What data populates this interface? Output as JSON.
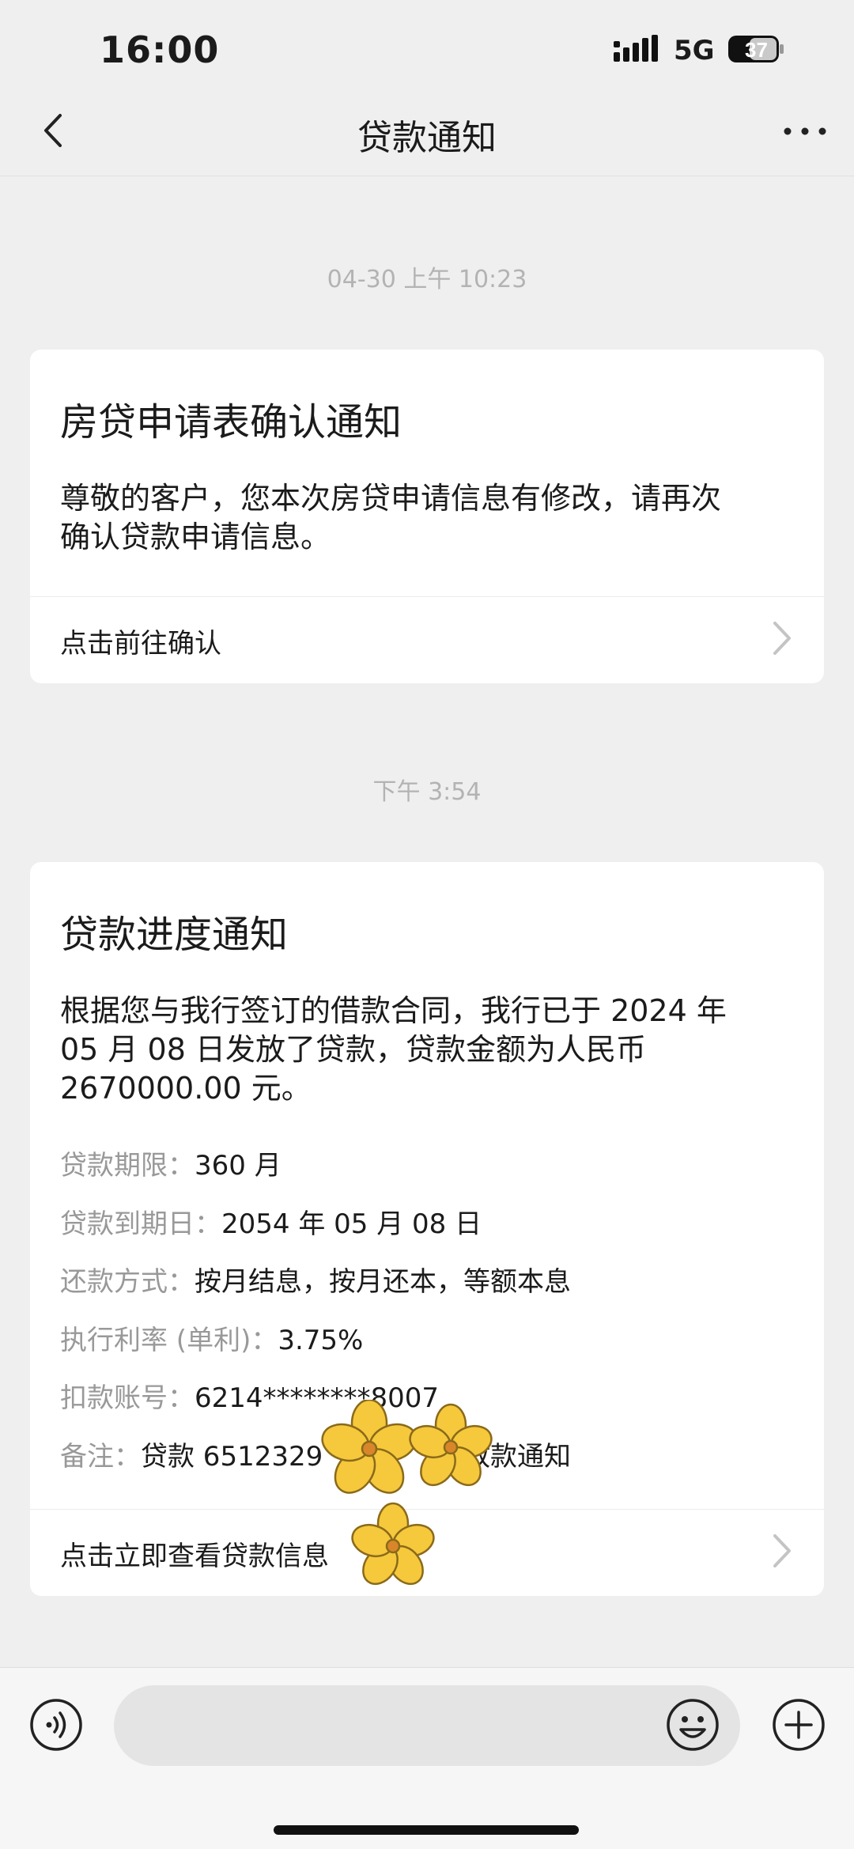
{
  "status_bar": {
    "time": "16:00",
    "network": "5G",
    "battery": "37"
  },
  "nav": {
    "title": "贷款通知",
    "back_icon": "back-arrow-icon",
    "more_icon": "more-dots-icon"
  },
  "messages": [
    {
      "timestamp": "04-30 上午 10:23",
      "title": "房贷申请表确认通知",
      "body_line1": "尊敬的客户，您本次房贷申请信息有修改，请再次",
      "body_line2": "确认贷款申请信息。",
      "link": "点击前往确认"
    },
    {
      "timestamp": "下午 3:54",
      "title": "贷款进度通知",
      "body_line1": "根据您与我行签订的借款合同，我行已于 2024 年",
      "body_line2": "05 月 08 日发放了贷款，贷款金额为人民币",
      "body_line3": "2670000.00 元。",
      "fields": [
        {
          "key": "贷款期限：",
          "value": "360 月"
        },
        {
          "key": "贷款到期日：",
          "value": "2054 年 05 月 08 日"
        },
        {
          "key": "还款方式：",
          "value": "按月结息，按月还本，等额本息"
        },
        {
          "key": "执行利率 (单利)：",
          "value": "3.75%"
        },
        {
          "key": "扣款账号：",
          "value": "6214********8007"
        },
        {
          "key": "备注：",
          "value": "贷款 6512329"
        },
        {
          "key": "",
          "value": "放款通知"
        }
      ],
      "link": "点击立即查看贷款信息"
    }
  ],
  "input_bar": {
    "voice_icon": "voice-icon",
    "emoji_icon": "emoji-icon",
    "plus_icon": "plus-icon"
  },
  "colors": {
    "background": "#efefef",
    "card": "#ffffff",
    "muted": "#999999",
    "flower": "#f4c234"
  }
}
